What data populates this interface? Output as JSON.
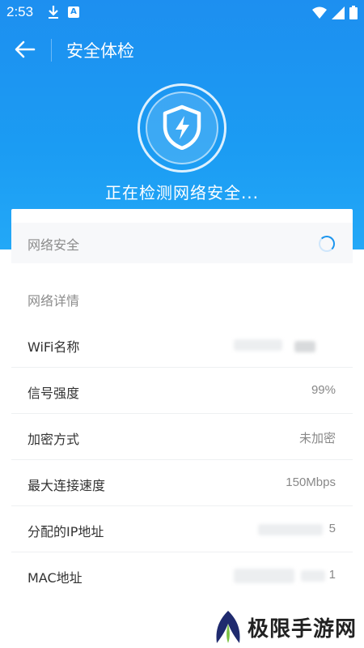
{
  "status_bar": {
    "time": "2:53"
  },
  "app_bar": {
    "title": "安全体检"
  },
  "scan": {
    "status_text": "正在检测网络安全..."
  },
  "sections": {
    "network_security": "网络安全",
    "network_details": "网络详情"
  },
  "details": [
    {
      "label": "WiFi名称",
      "value": ""
    },
    {
      "label": "信号强度",
      "value": "99%"
    },
    {
      "label": "加密方式",
      "value": "未加密"
    },
    {
      "label": "最大连接速度",
      "value": "150Mbps"
    },
    {
      "label": "分配的IP地址",
      "value": "5"
    },
    {
      "label": "MAC地址",
      "value": "1"
    }
  ],
  "watermark": {
    "text": "极限手游网"
  },
  "colors": {
    "primary": "#1d8ff0",
    "background": "#ffffff",
    "section_bg": "#f7f8fa"
  }
}
